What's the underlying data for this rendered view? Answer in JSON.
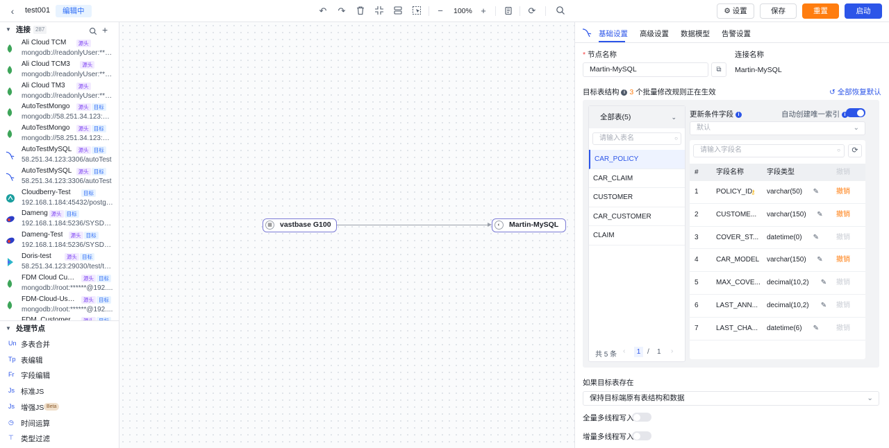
{
  "topbar": {
    "title": "test001",
    "status": "编辑中",
    "zoom": "100%",
    "settings_label": "设置",
    "save_label": "保存",
    "reset_label": "重置",
    "start_label": "启动"
  },
  "connections": {
    "title": "连接",
    "count": "287",
    "items": [
      {
        "name": "Ali Cloud TCM",
        "url": "mongodb://readonlyUser:***...",
        "src": "源头",
        "tgt": "",
        "icon": "mongodb-icon"
      },
      {
        "name": "Ali Cloud TCM3",
        "url": "mongodb://readonlyUser:***...",
        "src": "源头",
        "tgt": "",
        "icon": "mongodb-icon"
      },
      {
        "name": "Ali Cloud TM3",
        "url": "mongodb://readonlyUser:***...",
        "src": "源头",
        "tgt": "",
        "icon": "mongodb-icon"
      },
      {
        "name": "AutoTestMongo",
        "url": "mongodb://58.251.34.123:27...",
        "src": "源头",
        "tgt": "目标",
        "icon": "mongodb-icon"
      },
      {
        "name": "AutoTestMongo",
        "url": "mongodb://58.251.34.123:27...",
        "src": "源头",
        "tgt": "目标",
        "icon": "mongodb-icon"
      },
      {
        "name": "AutoTestMySQL",
        "url": "58.251.34.123:3306/autoTest",
        "src": "源头",
        "tgt": "目标",
        "icon": "mysql-icon"
      },
      {
        "name": "AutoTestMySQL",
        "url": "58.251.34.123:3306/autoTest",
        "src": "源头",
        "tgt": "目标",
        "icon": "mysql-icon"
      },
      {
        "name": "Cloudberry-Test",
        "url": "192.168.1.184:45432/postgr...",
        "src": "",
        "tgt": "目标",
        "icon": "cloudberry-icon"
      },
      {
        "name": "Dameng",
        "url": "192.168.1.184:5236/SYSDBA",
        "src": "源头",
        "tgt": "目标",
        "icon": "dameng-icon"
      },
      {
        "name": "Dameng-Test",
        "url": "192.168.1.184:5236/SYSDBA",
        "src": "源头",
        "tgt": "目标",
        "icon": "dameng-icon"
      },
      {
        "name": "Doris-test",
        "url": "58.251.34.123:29030/test/test",
        "src": "源头",
        "tgt": "目标",
        "icon": "doris-icon"
      },
      {
        "name": "FDM Cloud Cust...",
        "url": "mongodb://root:******@192....",
        "src": "源头",
        "tgt": "目标",
        "icon": "mongodb-icon"
      },
      {
        "name": "FDM-Cloud-Use...",
        "url": "mongodb://root:******@192....",
        "src": "源头",
        "tgt": "目标",
        "icon": "mongodb-icon"
      },
      {
        "name": "FDM_Customer...",
        "url": "",
        "src": "源头",
        "tgt": "目标",
        "icon": "mongodb-icon"
      }
    ]
  },
  "processors": {
    "title": "处理节点",
    "items": [
      {
        "icon": "Un",
        "label": "多表合并"
      },
      {
        "icon": "Tp",
        "label": "表编辑"
      },
      {
        "icon": "Fr",
        "label": "字段编辑"
      },
      {
        "icon": "Js",
        "label": "标准JS"
      },
      {
        "icon": "Js",
        "label": "增强JS",
        "badge": "Beta"
      },
      {
        "icon": "◷",
        "label": "时间运算"
      },
      {
        "icon": "⊤",
        "label": "类型过滤"
      }
    ]
  },
  "canvas": {
    "source_node": "vastbase G100",
    "target_node": "Martin-MySQL"
  },
  "panel": {
    "tabs": [
      "基础设置",
      "高级设置",
      "数据模型",
      "告警设置"
    ],
    "node_name_label": "节点名称",
    "node_name_value": "Martin-MySQL",
    "conn_name_label": "连接名称",
    "conn_name_value": "Martin-MySQL",
    "target_struct_label": "目标表结构",
    "batch_count": "3",
    "batch_text": "个批量修改规则正在生效",
    "restore_all": "全部恢复默认",
    "all_tables": "全部表(5)",
    "table_search_placeholder": "请输入表名",
    "tables": [
      "CAR_POLICY",
      "CAR_CLAIM",
      "CUSTOMER",
      "CAR_CUSTOMER",
      "CLAIM"
    ],
    "pager_total": "共 5 条",
    "pager_page": "1",
    "pager_sep": "/",
    "pager_pages": "1",
    "update_field_label": "更新条件字段",
    "auto_index_label": "自动创建唯一索引",
    "update_field_placeholder": "默认",
    "field_search_placeholder": "请输入字段名",
    "col_num": "#",
    "col_name": "字段名称",
    "col_type": "字段类型",
    "col_revoke": "撤销",
    "fields": [
      {
        "n": "1",
        "name": "POLICY_ID",
        "type": "varchar(50)",
        "revoke": "撤销",
        "active": true,
        "key": true
      },
      {
        "n": "2",
        "name": "CUSTOME...",
        "type": "varchar(150)",
        "revoke": "撤销",
        "active": true
      },
      {
        "n": "3",
        "name": "COVER_ST...",
        "type": "datetime(0)",
        "revoke": "撤销",
        "active": false
      },
      {
        "n": "4",
        "name": "CAR_MODEL",
        "type": "varchar(150)",
        "revoke": "撤销",
        "active": true
      },
      {
        "n": "5",
        "name": "MAX_COVE...",
        "type": "decimal(10,2)",
        "revoke": "撤销",
        "active": false
      },
      {
        "n": "6",
        "name": "LAST_ANN...",
        "type": "decimal(10,2)",
        "revoke": "撤销",
        "active": false
      },
      {
        "n": "7",
        "name": "LAST_CHA...",
        "type": "datetime(6)",
        "revoke": "撤销",
        "active": false
      }
    ],
    "if_exists_label": "如果目标表存在",
    "if_exists_value": "保持目标端原有表结构和数据",
    "full_mt_label": "全量多线程写入",
    "incr_mt_label": "增量多线程写入"
  },
  "colors": {
    "primary": "#2c55e8",
    "orange": "#ff7d0f",
    "source_tag": "#7b3ff2",
    "target_tag": "#2c6bf6"
  }
}
